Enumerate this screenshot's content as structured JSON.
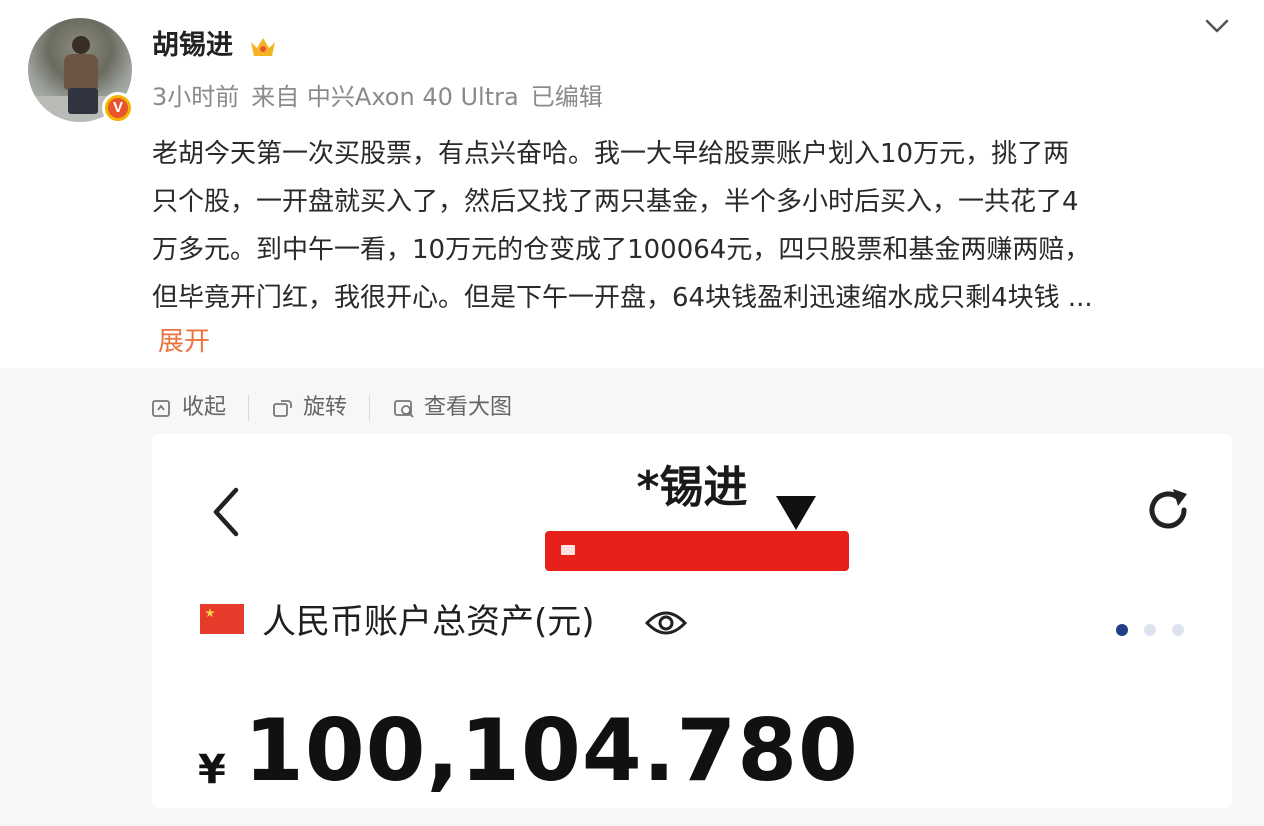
{
  "post": {
    "username": "胡锡进",
    "meta": {
      "time": "3小时前",
      "source": "来自 中兴Axon 40 Ultra",
      "edited": "已编辑"
    },
    "text_lines": [
      "老胡今天第一次买股票，有点兴奋哈。我一大早给股票账户划入10万元，挑了两",
      "只个股，一开盘就买入了，然后又找了两只基金，半个多小时后买入，一共花了4",
      "万多元。到中午一看，10万元的仓变成了100064元，四只股票和基金两赚两赔，",
      "但毕竟开门红，我很开心。但是下午一开盘，64块钱盈利迅速缩水成只剩4块钱 ..."
    ],
    "expand_label": "展开"
  },
  "media_toolbar": {
    "collapse": "收起",
    "rotate": "旋转",
    "view_large": "查看大图"
  },
  "screenshot": {
    "account_name": "*锡进",
    "total_assets_label": "人民币账户总资产(元)",
    "currency_symbol": "¥",
    "total_assets_value": "100,104.780"
  },
  "colors": {
    "accent_orange": "#eb7340",
    "redacted_bar": "#e8201a",
    "dot_active": "#1f3f86",
    "dot_inactive": "#dde4ef"
  },
  "icons": [
    "crown-icon",
    "chevron-down-icon",
    "verified-badge-icon",
    "collapse-icon",
    "rotate-icon",
    "view-large-icon",
    "back-arrow-icon",
    "dropdown-triangle-icon",
    "refresh-icon",
    "china-flag-icon",
    "eye-icon"
  ]
}
